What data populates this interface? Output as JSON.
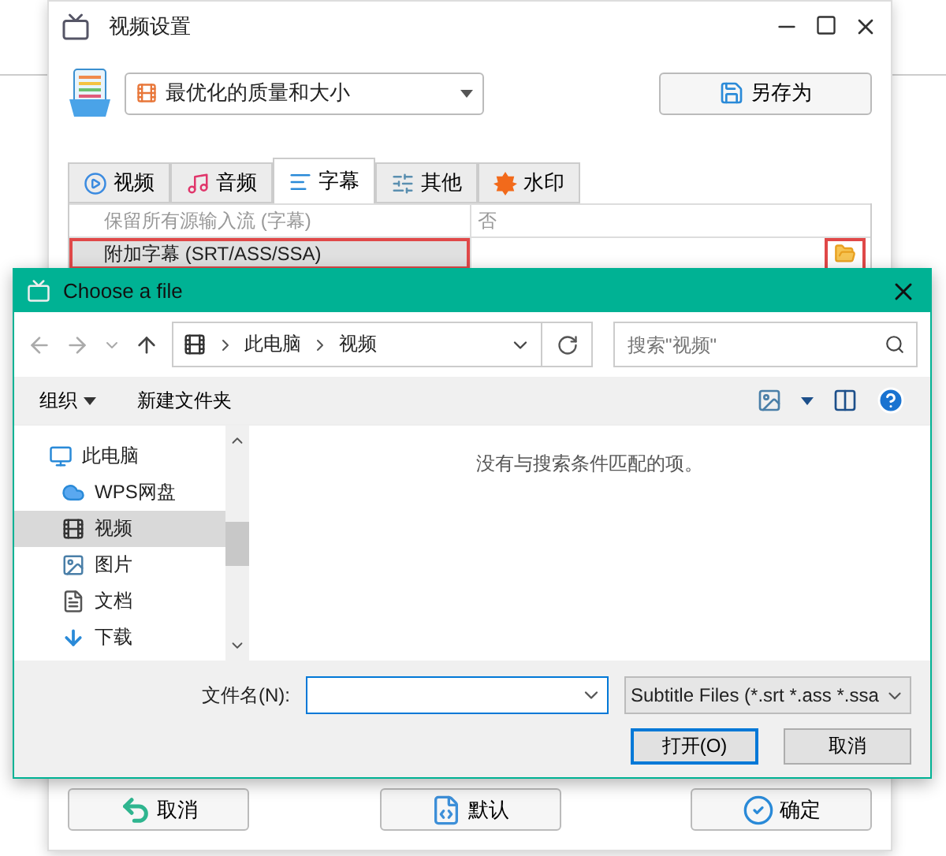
{
  "main_window": {
    "title": "视频设置",
    "preset": "最优化的质量和大小",
    "save_as_button": "另存为",
    "tabs": [
      {
        "label": "视频",
        "kind": "video",
        "selected": false
      },
      {
        "label": "音频",
        "kind": "audio",
        "selected": false
      },
      {
        "label": "字幕",
        "kind": "subtitle",
        "selected": true
      },
      {
        "label": "其他",
        "kind": "other",
        "selected": false
      },
      {
        "label": "水印",
        "kind": "watermark",
        "selected": false
      }
    ],
    "settings": [
      {
        "label": "保留所有源输入流 (字幕)",
        "value": "否",
        "kind": "choice",
        "disabled": true,
        "highlighted": false
      },
      {
        "label": "附加字幕 (SRT/ASS/SSA)",
        "kind": "file",
        "disabled": false,
        "highlighted": true
      }
    ],
    "buttons": [
      {
        "label": "取消",
        "kind": "cancel"
      },
      {
        "label": "默认",
        "kind": "default"
      },
      {
        "label": "确定",
        "kind": "ok"
      }
    ]
  },
  "file_dialog": {
    "title": "Choose a file",
    "path": [
      "此电脑",
      "视频"
    ],
    "search": {
      "placeholder": "搜索\"视频\""
    },
    "toolbar": {
      "organize": "组织",
      "new_folder": "新建文件夹"
    },
    "sidebar": [
      {
        "label": "此电脑",
        "kind": "pc",
        "selected": false,
        "children": [
          {
            "label": "WPS网盘",
            "kind": "cloud",
            "selected": false
          },
          {
            "label": "视频",
            "kind": "video",
            "selected": true
          },
          {
            "label": "图片",
            "kind": "picture",
            "selected": false
          },
          {
            "label": "文档",
            "kind": "document",
            "selected": false
          },
          {
            "label": "下载",
            "kind": "download",
            "selected": false
          }
        ]
      }
    ],
    "empty_message": "没有与搜索条件匹配的项。",
    "file_name_label": "文件名(N):",
    "file_type": "Subtitle Files (*.srt *.ass *.ssa",
    "open_button": "打开(O)",
    "cancel_button": "取消"
  }
}
